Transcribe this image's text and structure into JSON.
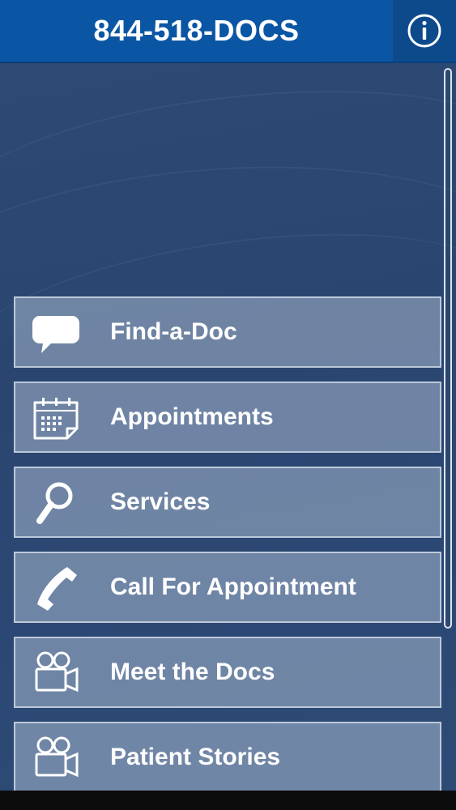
{
  "header": {
    "title": "844-518-DOCS",
    "info_icon": "info-circle-icon"
  },
  "menu": {
    "items": [
      {
        "label": "Find-a-Doc",
        "icon": "speech-bubble-icon"
      },
      {
        "label": "Appointments",
        "icon": "calendar-icon"
      },
      {
        "label": "Services",
        "icon": "magnifier-icon"
      },
      {
        "label": "Call For Appointment",
        "icon": "phone-handset-icon"
      },
      {
        "label": "Meet the Docs",
        "icon": "video-camera-icon"
      },
      {
        "label": "Patient Stories",
        "icon": "video-camera-icon"
      }
    ]
  },
  "colors": {
    "header_bg": "#0b56a4",
    "background": "#2b4773",
    "button_bg": "#8a9bb4"
  }
}
